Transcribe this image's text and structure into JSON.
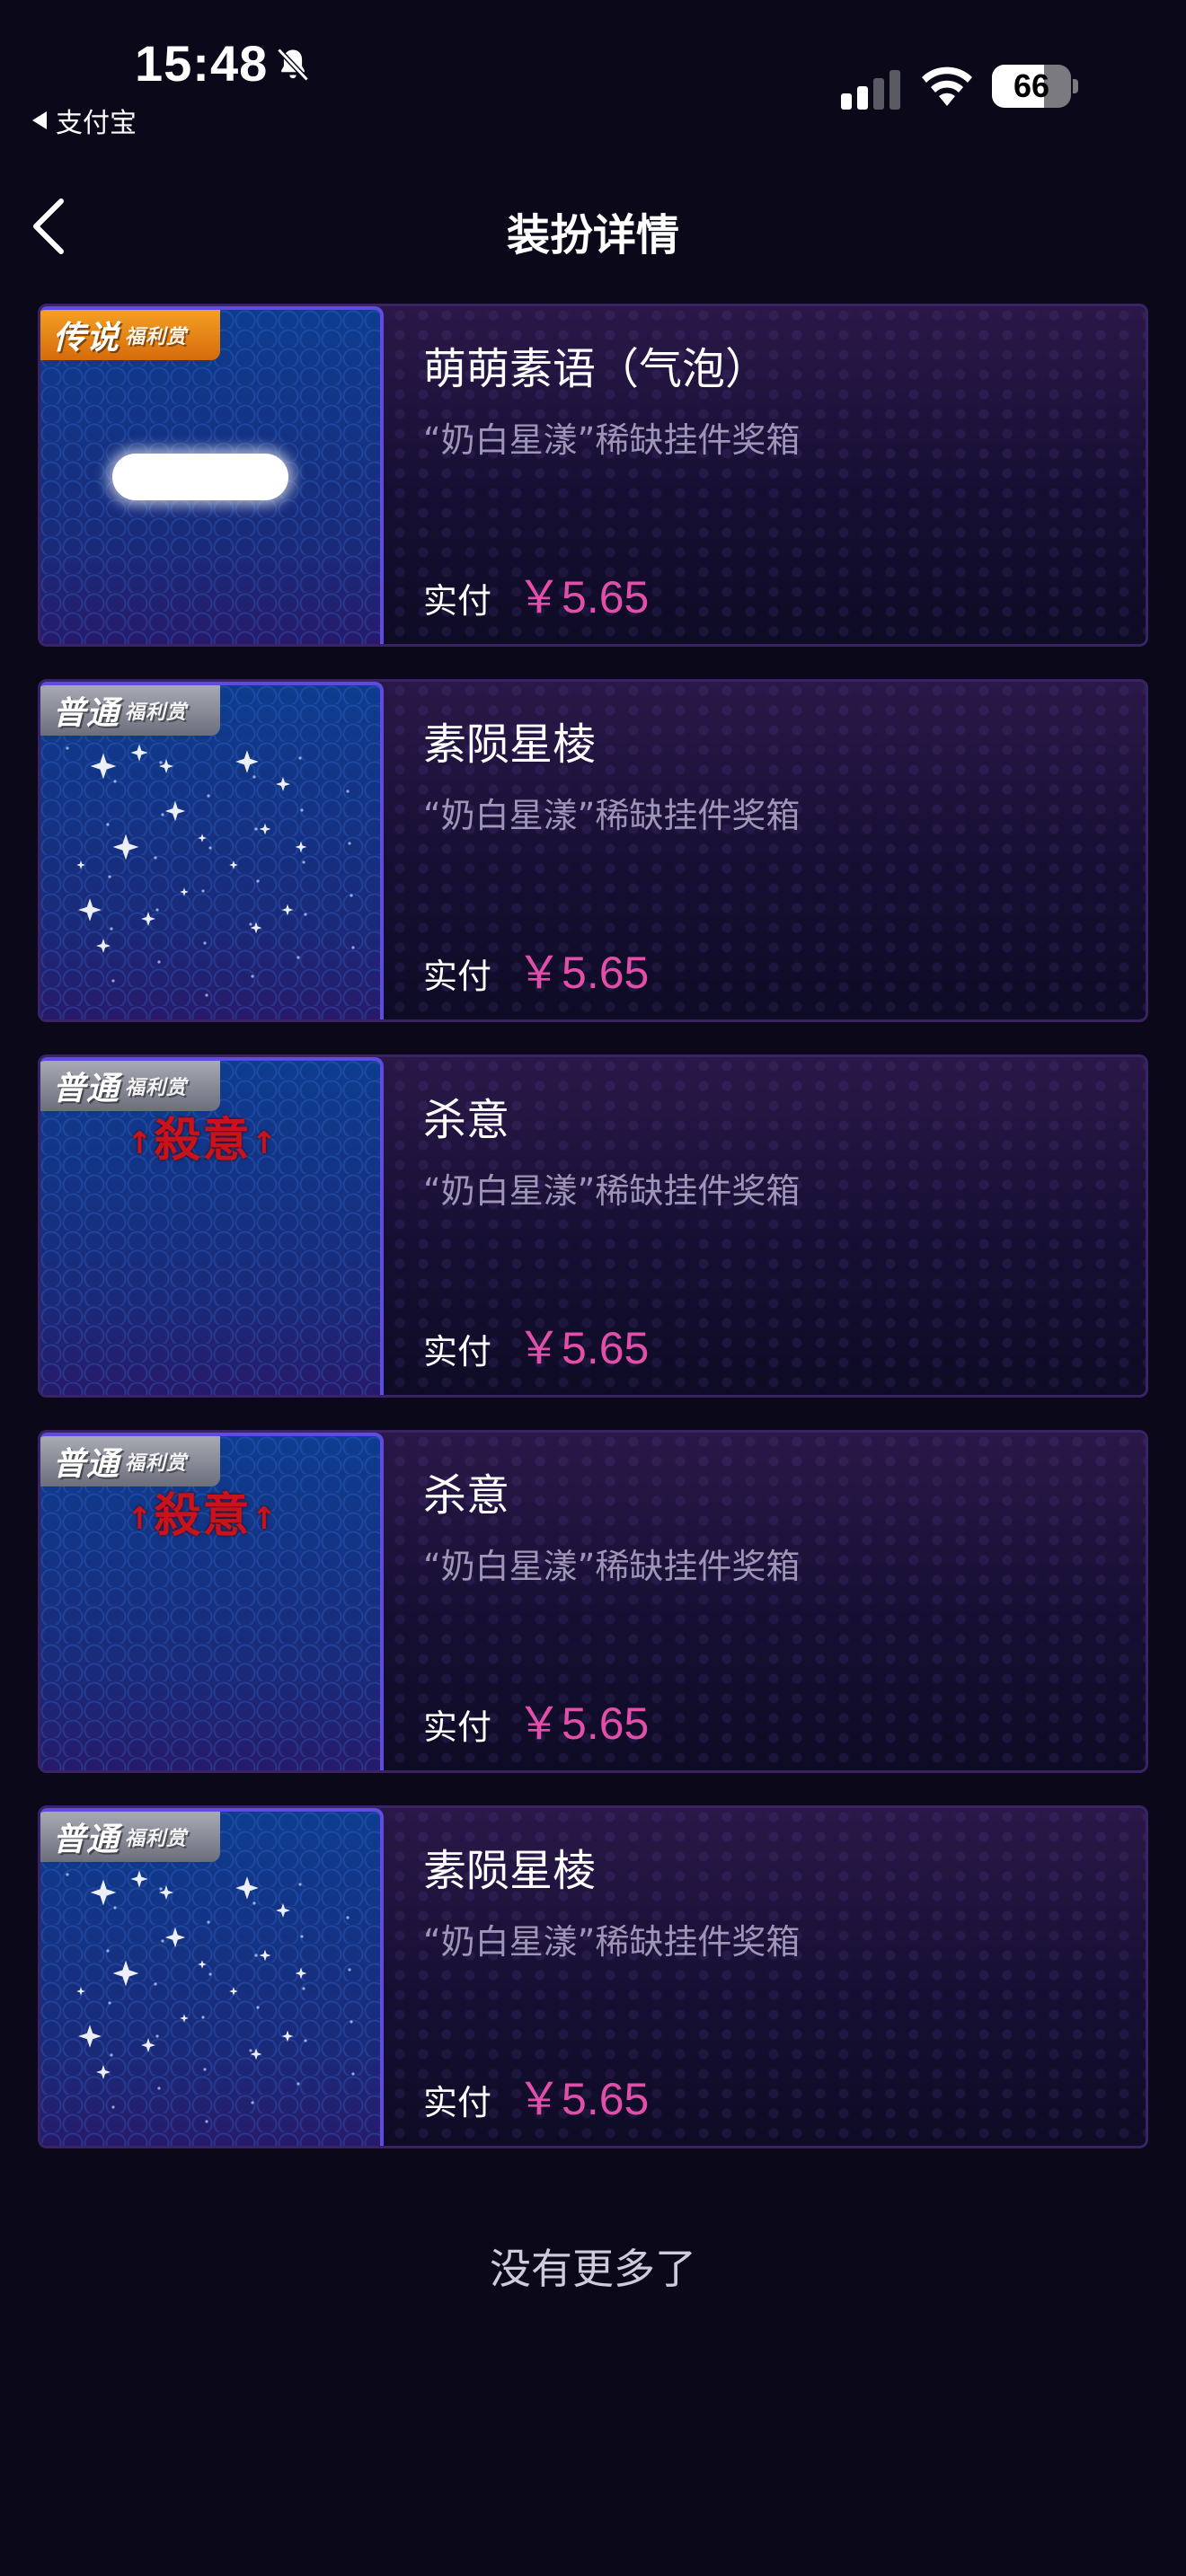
{
  "status_bar": {
    "time": "15:48",
    "back_app": "支付宝",
    "battery_percent": "66",
    "battery_level": 0.66
  },
  "nav": {
    "title": "装扮详情"
  },
  "items": [
    {
      "rarity": "传说",
      "rarity_sub": "福利赏",
      "rarity_color": "#f39a22",
      "preview": "bubble",
      "name": "萌萌素语（气泡）",
      "source": "“奶白星漾”稀缺挂件奖箱",
      "price_label": "实付",
      "price": "￥5.65"
    },
    {
      "rarity": "普通",
      "rarity_sub": "福利赏",
      "rarity_color": "#8b8e99",
      "preview": "stars",
      "name": "素陨星棱",
      "source": "“奶白星漾”稀缺挂件奖箱",
      "price_label": "实付",
      "price": "￥5.65"
    },
    {
      "rarity": "普通",
      "rarity_sub": "福利赏",
      "rarity_color": "#8b8e99",
      "preview": "kill",
      "preview_text": "殺意",
      "name": "杀意",
      "source": "“奶白星漾”稀缺挂件奖箱",
      "price_label": "实付",
      "price": "￥5.65"
    },
    {
      "rarity": "普通",
      "rarity_sub": "福利赏",
      "rarity_color": "#8b8e99",
      "preview": "kill",
      "preview_text": "殺意",
      "name": "杀意",
      "source": "“奶白星漾”稀缺挂件奖箱",
      "price_label": "实付",
      "price": "￥5.65"
    },
    {
      "rarity": "普通",
      "rarity_sub": "福利赏",
      "rarity_color": "#8b8e99",
      "preview": "stars",
      "name": "素陨星棱",
      "source": "“奶白星漾”稀缺挂件奖箱",
      "price_label": "实付",
      "price": "￥5.65"
    }
  ],
  "footer": {
    "no_more": "没有更多了"
  },
  "icons": {
    "bell": "bell-slash-icon",
    "signal": "cellular-signal-icon",
    "wifi": "wifi-icon",
    "battery": "battery-icon",
    "back": "chevron-left-icon"
  }
}
